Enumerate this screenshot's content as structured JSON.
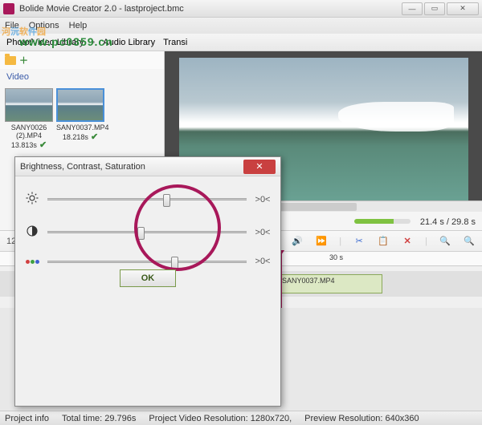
{
  "window": {
    "title": "Bolide Movie Creator 2.0 - lastproject.bmc",
    "min_label": "—",
    "max_label": "▭",
    "close_label": "✕"
  },
  "menu": {
    "file": "File",
    "options": "Options",
    "help": "Help"
  },
  "tabs": {
    "photo_video": "Photo/Video Library",
    "audio": "Audio Library",
    "transi": "Transi"
  },
  "library": {
    "section_label": "Video",
    "items": [
      {
        "name": "SANY0026 (2).MP4",
        "duration": "13.813s"
      },
      {
        "name": "SANY0037.MP4",
        "duration": "18.218s"
      }
    ]
  },
  "playback": {
    "time_current": "21.4 s",
    "time_total": "29.8 s",
    "separator": " / "
  },
  "timeline_toolbar": {
    "icons": [
      "zoom-label-128",
      "divider",
      "text-icon",
      "brightness-icon",
      "volume-icon",
      "speed-icon",
      "divider",
      "scissors-icon",
      "clipboard-icon",
      "delete-icon",
      "divider",
      "zoom-out-icon",
      "zoom-in-icon"
    ],
    "tick_label": "30 s",
    "clip_name": "SANY0037.MP4"
  },
  "status": {
    "project_info": "Project info",
    "total_time_label": "Total time:",
    "total_time_value": "29.796s",
    "video_res_label": "Project Video Resolution:",
    "video_res_value": "1280x720,",
    "preview_res_label": "Preview Resolution:",
    "preview_res_value": "640x360"
  },
  "dialog": {
    "title": "Brightness, Contrast, Saturation",
    "reset_text": ">0<",
    "ok_label": "OK",
    "rows": [
      {
        "name": "brightness",
        "pos": 58
      },
      {
        "name": "contrast",
        "pos": 45
      },
      {
        "name": "saturation",
        "pos": 62
      }
    ]
  },
  "watermark": {
    "url": "www.pc0359.cn"
  },
  "colors": {
    "accent": "#a8185a"
  }
}
